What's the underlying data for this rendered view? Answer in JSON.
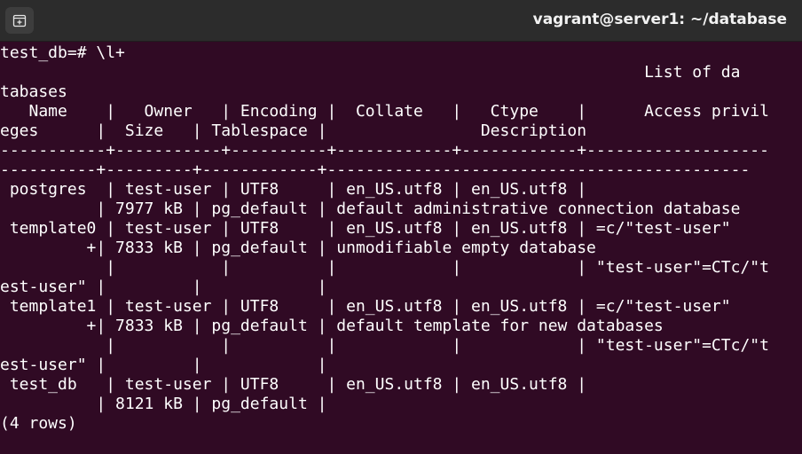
{
  "window": {
    "title": "vagrant@server1: ~/database",
    "new_tab_icon": "new-tab-icon"
  },
  "terminal": {
    "lines": [
      "test_db=# \\l+",
      "                                                                   List of da",
      "tabases",
      "   Name    |   Owner   | Encoding |  Collate   |   Ctype    |      Access privil",
      "eges      |  Size   | Tablespace |                Description",
      "-----------+-----------+----------+------------+------------+-------------------",
      "----------+---------+------------+--------------------------------------------",
      " postgres  | test-user | UTF8     | en_US.utf8 | en_US.utf8 |",
      "          | 7977 kB | pg_default | default administrative connection database",
      " template0 | test-user | UTF8     | en_US.utf8 | en_US.utf8 | =c/\"test-user\"",
      "         +| 7833 kB | pg_default | unmodifiable empty database",
      "           |           |          |            |            | \"test-user\"=CTc/\"t",
      "est-user\" |         |            |",
      " template1 | test-user | UTF8     | en_US.utf8 | en_US.utf8 | =c/\"test-user\"",
      "         +| 7833 kB | pg_default | default template for new databases",
      "           |           |          |            |            | \"test-user\"=CTc/\"t",
      "est-user\" |         |            |",
      " test_db   | test-user | UTF8     | en_US.utf8 | en_US.utf8 |",
      "          | 8121 kB | pg_default |",
      "(4 rows)"
    ]
  }
}
